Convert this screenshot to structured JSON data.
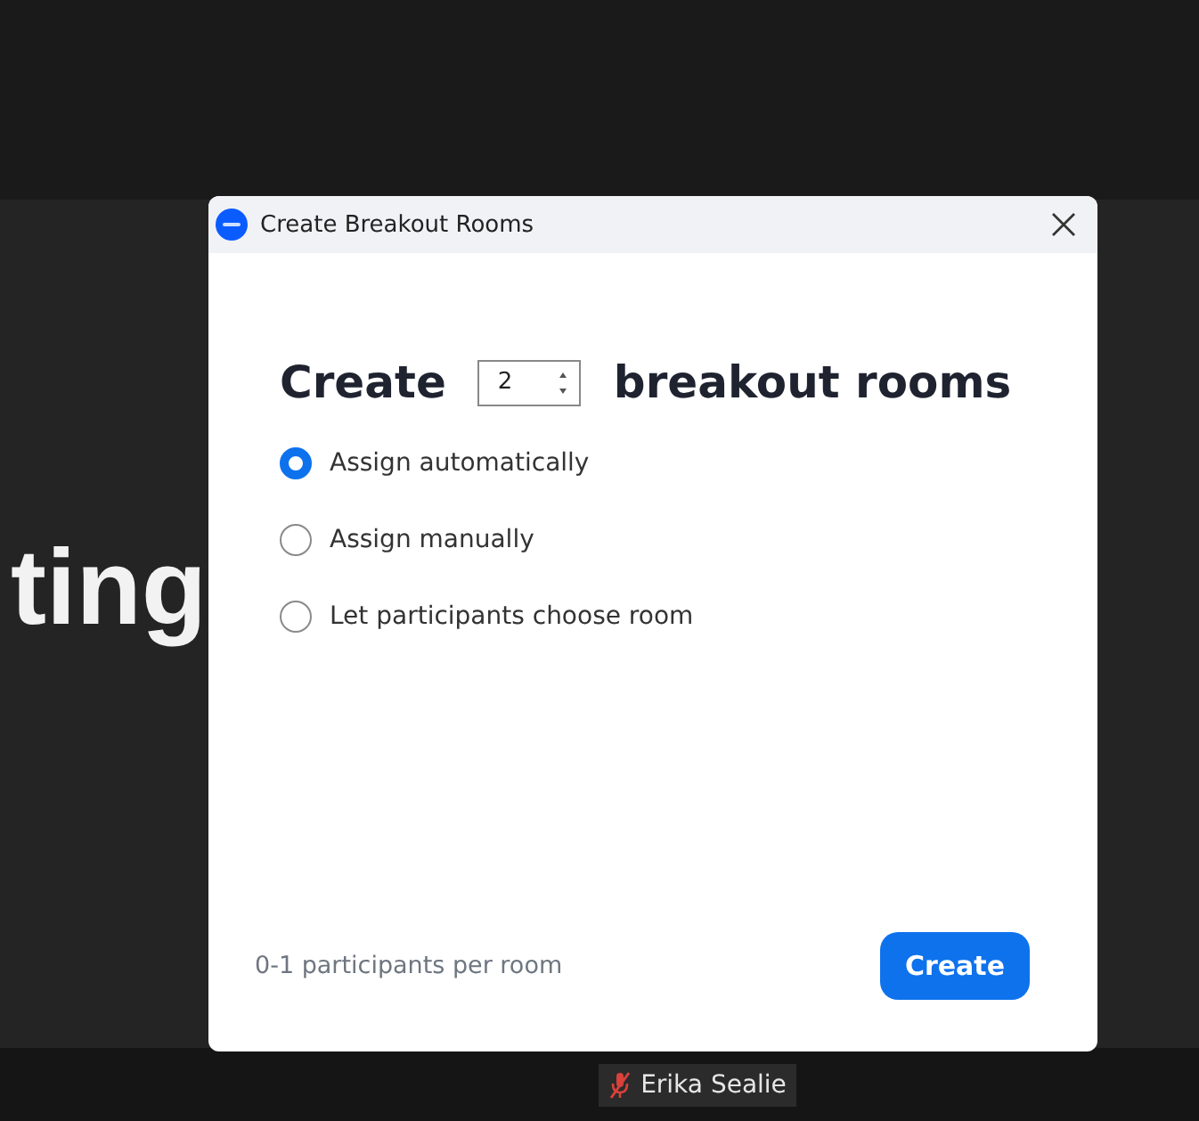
{
  "background": {
    "text": "ting"
  },
  "dialog": {
    "title": "Create Breakout Rooms",
    "heading_before": "Create",
    "room_count": "2",
    "heading_after": "breakout rooms",
    "options": [
      {
        "label": "Assign automatically",
        "selected": true
      },
      {
        "label": "Assign manually",
        "selected": false
      },
      {
        "label": "Let participants choose room",
        "selected": false
      }
    ],
    "footer_note": "0-1 participants per room",
    "button": "Create"
  },
  "name_tag": {
    "name": "Erika Sealie",
    "muted": true
  }
}
